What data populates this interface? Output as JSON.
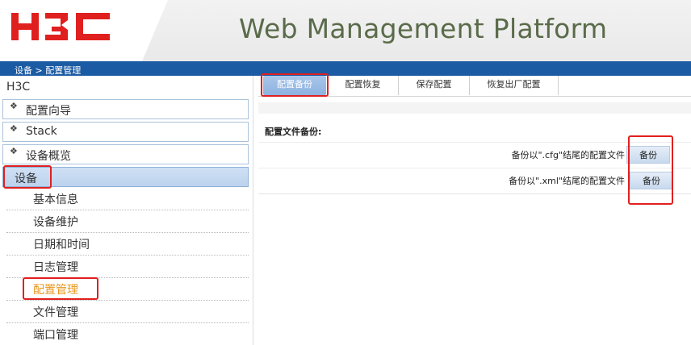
{
  "header": {
    "logo_text": "H3C",
    "title": "Web Management Platform",
    "colors": {
      "logo": "#e0201f",
      "title": "#5a6b4a",
      "bar": "#1b5ba3"
    }
  },
  "breadcrumb": "设备 > 配置管理",
  "sidebar": {
    "root": "H3C",
    "groups": [
      {
        "label": "配置向导",
        "icon": "diamond-icon"
      },
      {
        "label": "Stack",
        "icon": "diamond-icon"
      },
      {
        "label": "设备概览",
        "icon": "diamond-icon"
      },
      {
        "label": "设备",
        "active": true
      }
    ],
    "sub_items": [
      {
        "label": "基本信息"
      },
      {
        "label": "设备维护"
      },
      {
        "label": "日期和时间"
      },
      {
        "label": "日志管理"
      },
      {
        "label": "配置管理",
        "current": true
      },
      {
        "label": "文件管理"
      },
      {
        "label": "端口管理"
      }
    ]
  },
  "tabs": [
    {
      "label": "配置备份",
      "active": true
    },
    {
      "label": "配置恢复"
    },
    {
      "label": "保存配置"
    },
    {
      "label": "恢复出厂配置"
    }
  ],
  "main": {
    "section_title": "配置文件备份:",
    "rows": [
      {
        "label": "备份以\".cfg\"结尾的配置文件",
        "button": "备份"
      },
      {
        "label": "备份以\".xml\"结尾的配置文件",
        "button": "备份"
      }
    ]
  }
}
